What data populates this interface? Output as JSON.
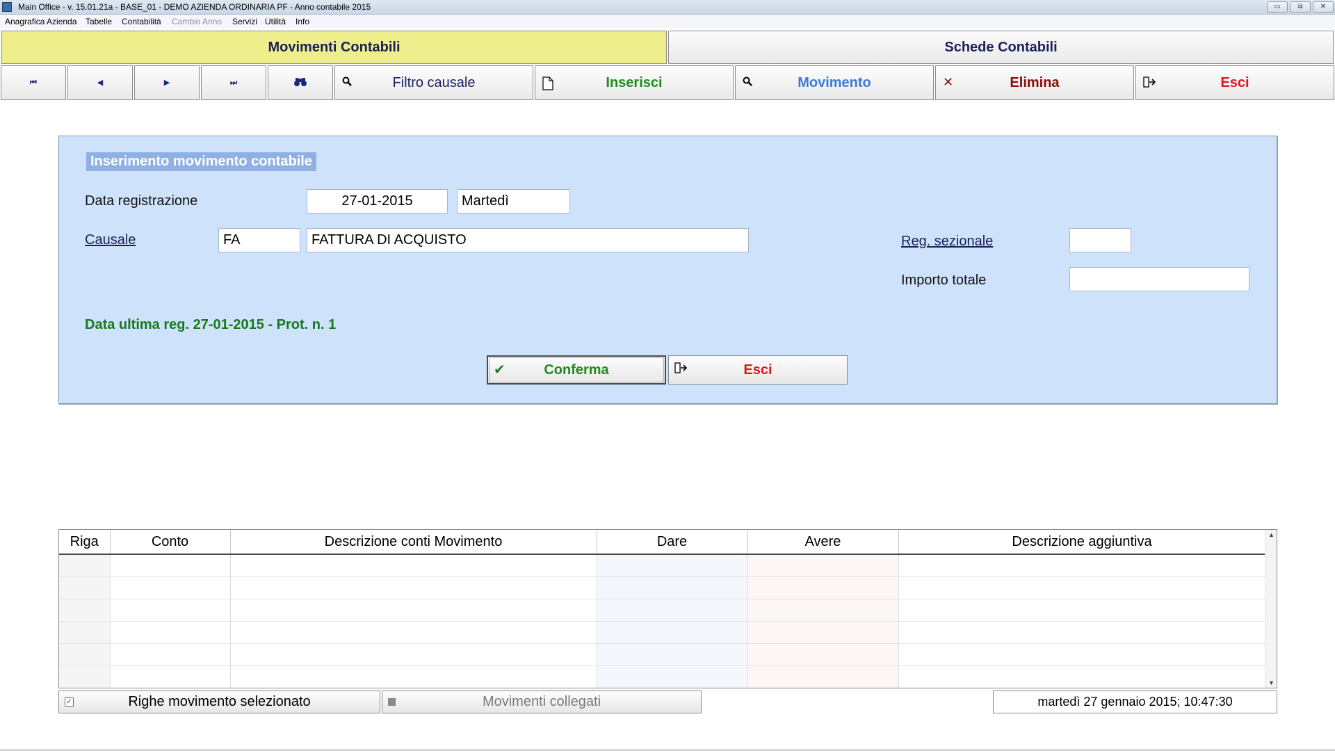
{
  "window": {
    "title": "Main Office - v. 15.01.21a - BASE_01 - DEMO AZIENDA ORDINARIA PF - Anno contabile 2015",
    "minimize_label": "▭",
    "restore_label": "⧉",
    "close_label": "✕"
  },
  "menu": {
    "items": [
      "Anagrafica Azienda",
      "Tabelle",
      "Contabilità",
      "Cambio Anno",
      "Servizi",
      "Utilità",
      "Info"
    ]
  },
  "tabs": {
    "movimenti": "Movimenti Contabili",
    "schede": "Schede Contabili"
  },
  "toolbar": {
    "first_icon": "⏮",
    "prev_icon": "◀",
    "next_icon": "▶",
    "last_icon": "⏭",
    "filtro_label": "Filtro causale",
    "inserisci_label": "Inserisci",
    "movimento_label": "Movimento",
    "elimina_label": "Elimina",
    "esci_label": "Esci",
    "colors": {
      "inserisci": "#1f8a1f",
      "movimento": "#3b7ad8",
      "elimina": "#8b0a0a",
      "esci": "#e0141b",
      "filtro": "#1a1f5c"
    }
  },
  "form": {
    "title": "Inserimento movimento contabile",
    "data_registrazione_label": "Data registrazione",
    "data_registrazione_value": "27-01-2015",
    "giorno_value": "Martedì",
    "causale_label": "Causale",
    "causale_code": "FA",
    "causale_desc": "FATTURA DI ACQUISTO",
    "reg_sezionale_label": "Reg. sezionale",
    "reg_sezionale_value": "",
    "importo_totale_label": "Importo totale",
    "importo_totale_value": "",
    "status_text": "Data ultima reg. 27-01-2015 - Prot. n. 1",
    "conferma_label": "Conferma",
    "esci_label": "Esci"
  },
  "grid": {
    "columns": [
      "Riga",
      "Conto",
      "Descrizione conti Movimento",
      "Dare",
      "Avere",
      "Descrizione aggiuntiva"
    ],
    "rows": [
      [
        "",
        "",
        "",
        "",
        "",
        ""
      ],
      [
        "",
        "",
        "",
        "",
        "",
        ""
      ],
      [
        "",
        "",
        "",
        "",
        "",
        ""
      ],
      [
        "",
        "",
        "",
        "",
        "",
        ""
      ],
      [
        "",
        "",
        "",
        "",
        "",
        ""
      ],
      [
        "",
        "",
        "",
        "",
        "",
        ""
      ]
    ]
  },
  "bottom": {
    "righe_label": "Righe movimento selezionato",
    "righe_checked": true,
    "collegati_label": "Movimenti collegati",
    "datetime": "martedì 27 gennaio 2015; 10:47:30"
  }
}
